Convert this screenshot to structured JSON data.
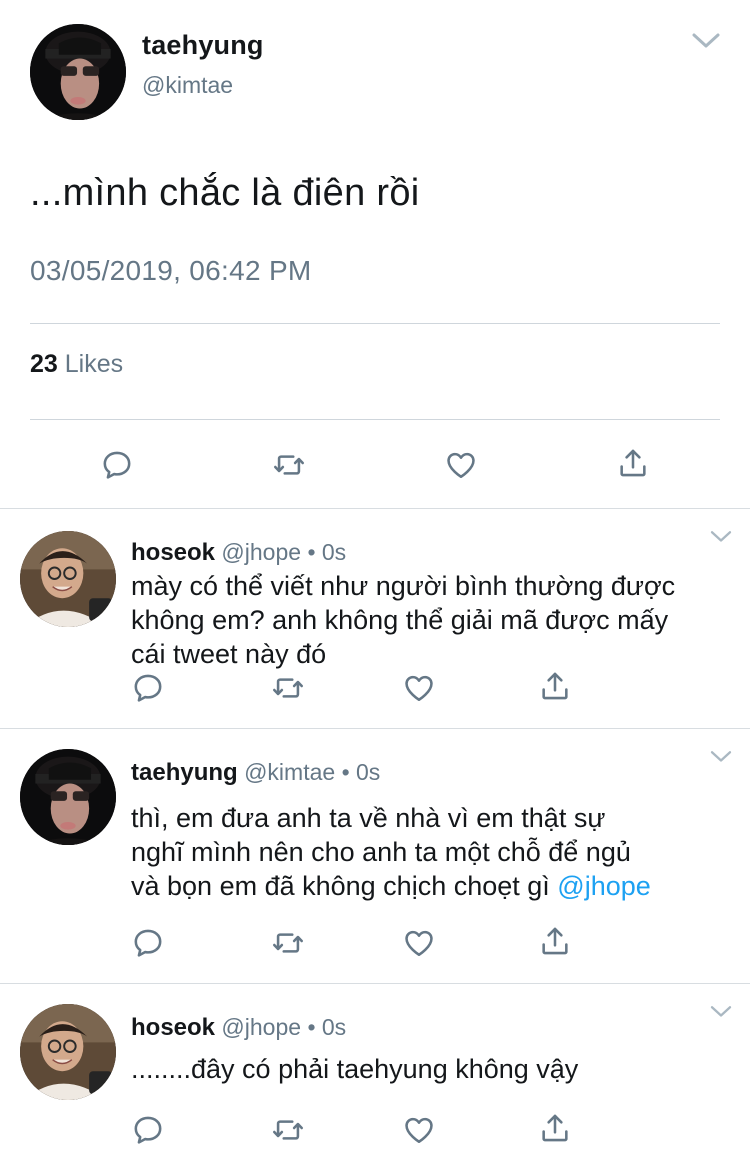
{
  "main_tweet": {
    "name": "taehyung",
    "handle": "@kimtae",
    "text": "...mình chắc là điên rồi",
    "timestamp": "03/05/2019, 06:42 PM",
    "likes_count": "23",
    "likes_label": "Likes",
    "actions": [
      "reply-icon",
      "retweet-icon",
      "like-icon",
      "share-icon"
    ]
  },
  "replies": [
    {
      "name": "hoseok",
      "handle": "@jhope",
      "dot": "•",
      "time": "0s",
      "lines": [
        "mày có thể viết như người bình thường được",
        "không em? anh không thể giải mã được mấy",
        "cái tweet này đó"
      ]
    },
    {
      "name": "taehyung",
      "handle": "@kimtae",
      "dot": "•",
      "time": "0s",
      "lines": [
        "thì, em đưa anh ta về nhà vì em thật sự",
        "nghĩ mình nên cho anh ta một chỗ để ngủ",
        "và bọn em đã không chịch choẹt gì "
      ],
      "mention": "@jhope"
    },
    {
      "name": "hoseok",
      "handle": "@jhope",
      "dot": "•",
      "time": "0s",
      "lines": [
        "........đây có phải taehyung không vậy"
      ]
    }
  ],
  "colors": {
    "text": "#14171a",
    "secondary": "#657786",
    "mention": "#1da1f2",
    "divider": "#cfd6dc"
  }
}
